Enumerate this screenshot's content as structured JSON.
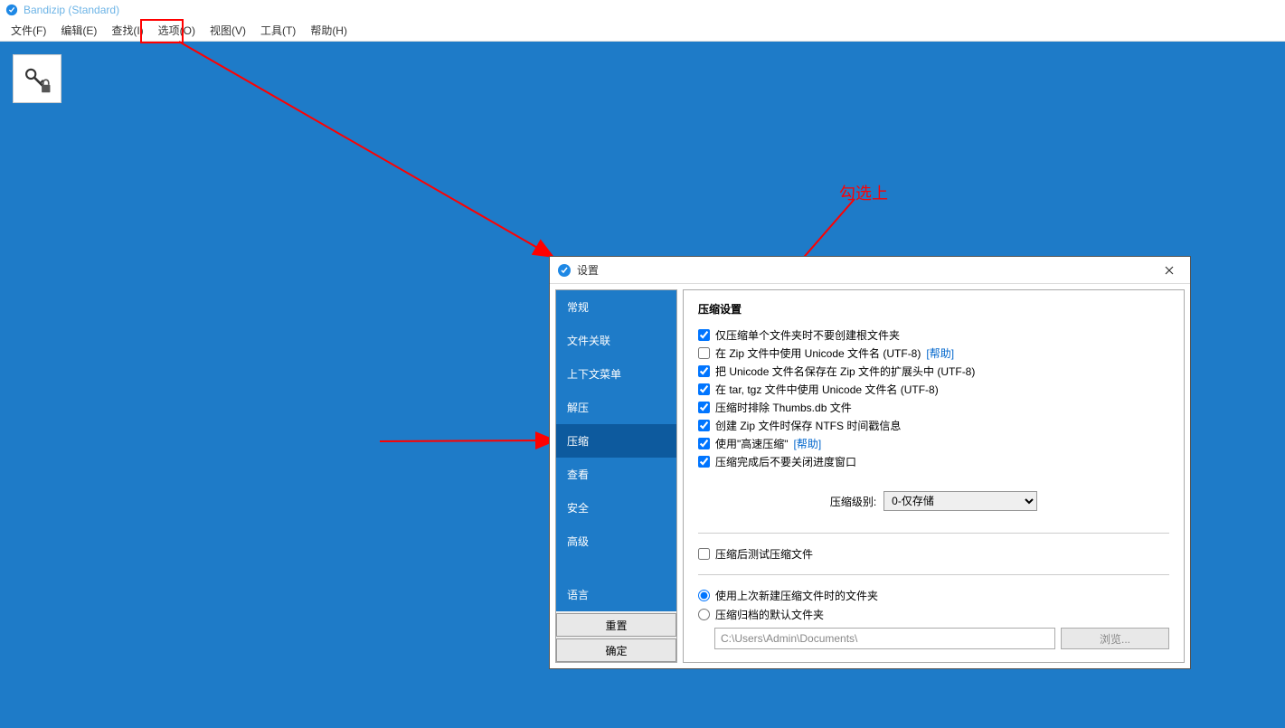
{
  "app": {
    "title": "Bandizip (Standard)"
  },
  "menu": {
    "file": "文件(F)",
    "edit": "编辑(E)",
    "find": "查找(I)",
    "options": "选项(O)",
    "view": "视图(V)",
    "tools": "工具(T)",
    "help": "帮助(H)"
  },
  "annotations": {
    "check_it": "勾选上"
  },
  "dialog": {
    "title": "设置",
    "sidebar": {
      "general": "常规",
      "file_assoc": "文件关联",
      "context_menu": "上下文菜单",
      "extract": "解压",
      "compress": "压缩",
      "view": "查看",
      "security": "安全",
      "advanced": "高级",
      "language": "语言",
      "reset": "重置",
      "ok": "确定"
    },
    "content": {
      "section_title": "压缩设置",
      "cb1": "仅压缩单个文件夹时不要创建根文件夹",
      "cb2": "在 Zip 文件中使用 Unicode 文件名 (UTF-8)",
      "cb2_help": "[帮助]",
      "cb3": "把 Unicode 文件名保存在 Zip 文件的扩展头中 (UTF-8)",
      "cb4": "在 tar, tgz 文件中使用 Unicode 文件名 (UTF-8)",
      "cb5": "压缩时排除 Thumbs.db 文件",
      "cb6": "创建 Zip 文件时保存 NTFS 时间戳信息",
      "cb7": "使用\"高速压缩\"",
      "cb7_help": "[帮助]",
      "cb8": "压缩完成后不要关闭进度窗口",
      "level_label": "压缩级别:",
      "level_value": "0-仅存储",
      "cb_test": "压缩后测试压缩文件",
      "radio_last": "使用上次新建压缩文件时的文件夹",
      "radio_default": "压缩归档的默认文件夹",
      "path_value": "C:\\Users\\Admin\\Documents\\",
      "browse": "浏览..."
    }
  }
}
